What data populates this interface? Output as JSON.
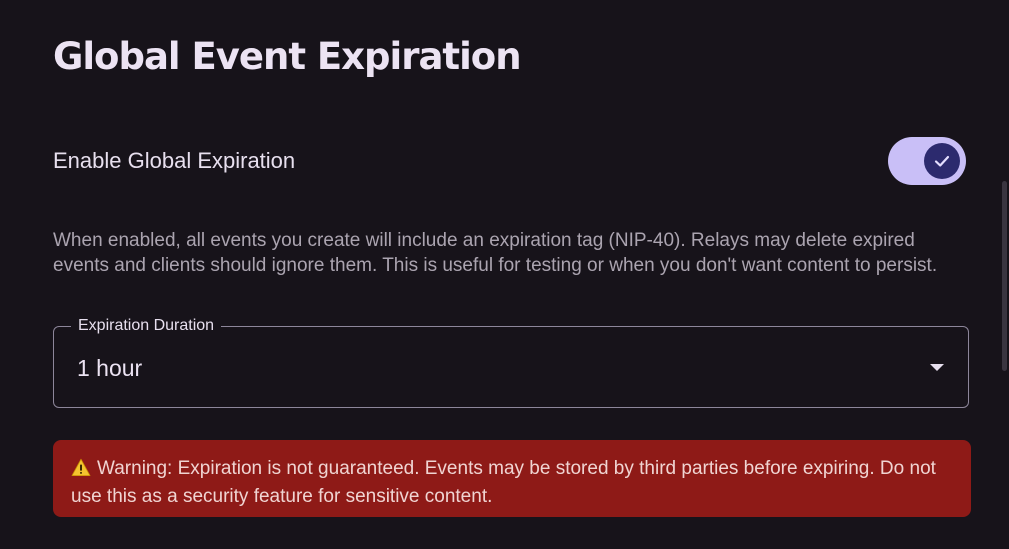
{
  "header": {
    "title": "Global Event Expiration"
  },
  "toggle": {
    "label": "Enable Global Expiration",
    "checked": true,
    "color_track": "#c9bff7",
    "color_thumb": "#2c2a6e"
  },
  "description": "When enabled, all events you create will include an expiration tag (NIP-40). Relays may delete expired events and clients should ignore them. This is useful for testing or when you don't want content to persist.",
  "duration_select": {
    "label": "Expiration Duration",
    "value": "1 hour",
    "icon": "chevron-down-icon"
  },
  "warning": {
    "icon": "warning-triangle-icon",
    "text": "Warning: Expiration is not guaranteed. Events may be stored by third parties before expiring. Do not use this as a security feature for sensitive content.",
    "color_background": "#8e1a17"
  }
}
